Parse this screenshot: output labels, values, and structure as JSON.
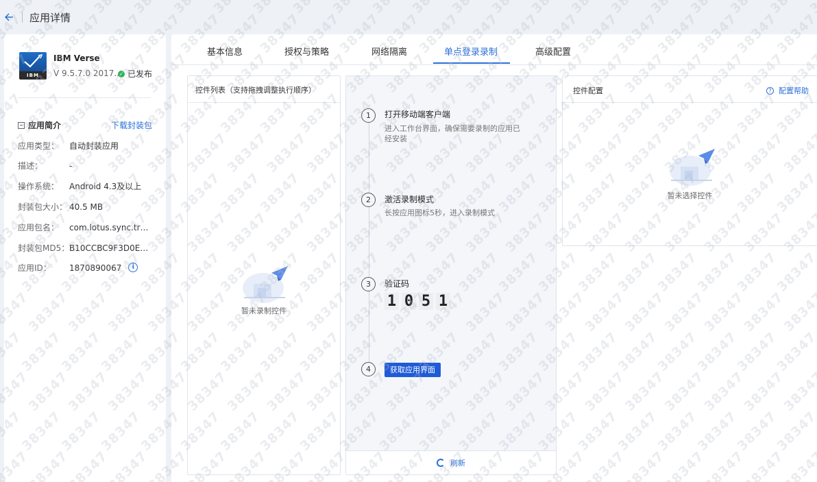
{
  "header": {
    "title": "应用详情"
  },
  "app": {
    "name": "IBM Verse",
    "logo_text": "IBM",
    "version": "V 9.5.7.0 2017...",
    "status": "已发布",
    "status_color": "#2db35a"
  },
  "summary": {
    "title": "应用简介",
    "download_label": "下载封装包",
    "rows": [
      {
        "label": "应用类型：",
        "value": "自动封装应用"
      },
      {
        "label": "描述：",
        "value": "-"
      },
      {
        "label": "操作系统：",
        "value": "Android 4.3及以上"
      },
      {
        "label": "封装包大小：",
        "value": "40.5 MB"
      },
      {
        "label": "应用包名：",
        "value": "com.lotus.sync.trave..."
      },
      {
        "label": "封装包MD5：",
        "value": "B10CCBC9F3D0EE19..."
      },
      {
        "label": "应用ID：",
        "value": "1870890067"
      }
    ]
  },
  "tabs": [
    {
      "label": "基本信息"
    },
    {
      "label": "授权与策略"
    },
    {
      "label": "网络隔离"
    },
    {
      "label": "单点登录录制"
    },
    {
      "label": "高级配置"
    }
  ],
  "control_list": {
    "title": "控件列表（支持拖拽调整执行顺序）",
    "empty_text": "暂未录制控件"
  },
  "steps": [
    {
      "num": "1",
      "title": "打开移动端客户端",
      "desc": "进入工作台界面，确保需要录制的应用已经安装"
    },
    {
      "num": "2",
      "title": "激活录制模式",
      "desc": "长按应用图标5秒，进入录制模式"
    },
    {
      "num": "3",
      "title": "验证码",
      "code": [
        "1",
        "0",
        "5",
        "1"
      ]
    },
    {
      "num": "4",
      "button_label": "获取应用界面"
    }
  ],
  "refresh_label": "刷新",
  "config": {
    "title": "控件配置",
    "help_label": "配置帮助",
    "empty_text": "暂未选择控件"
  },
  "watermark": "38347",
  "colors": {
    "accent": "#2a6fd8",
    "primary_button": "#1e5bd6",
    "success": "#2db35a"
  }
}
